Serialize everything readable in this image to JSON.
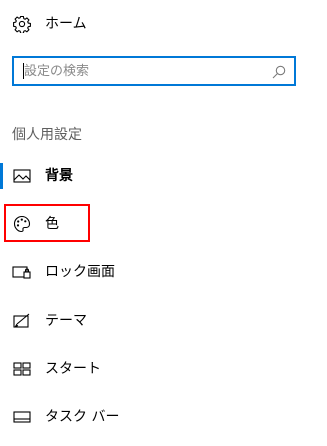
{
  "home": {
    "label": "ホーム",
    "icon": "gear-icon"
  },
  "search": {
    "placeholder": "設定の検索",
    "value": "",
    "icon": "search-icon",
    "accent_color": "#0078d7"
  },
  "section": {
    "title": "個人用設定"
  },
  "nav_items": [
    {
      "label": "背景",
      "icon": "picture-icon",
      "selected": true
    },
    {
      "label": "色",
      "icon": "palette-icon",
      "selected": false,
      "highlighted": true
    },
    {
      "label": "ロック画面",
      "icon": "lock-screen-icon",
      "selected": false
    },
    {
      "label": "テーマ",
      "icon": "theme-icon",
      "selected": false
    },
    {
      "label": "スタート",
      "icon": "start-icon",
      "selected": false
    },
    {
      "label": "タスク バー",
      "icon": "taskbar-icon",
      "selected": false
    }
  ],
  "colors": {
    "selection_indicator": "#0078d7",
    "annotation_highlight": "#ff0000"
  }
}
